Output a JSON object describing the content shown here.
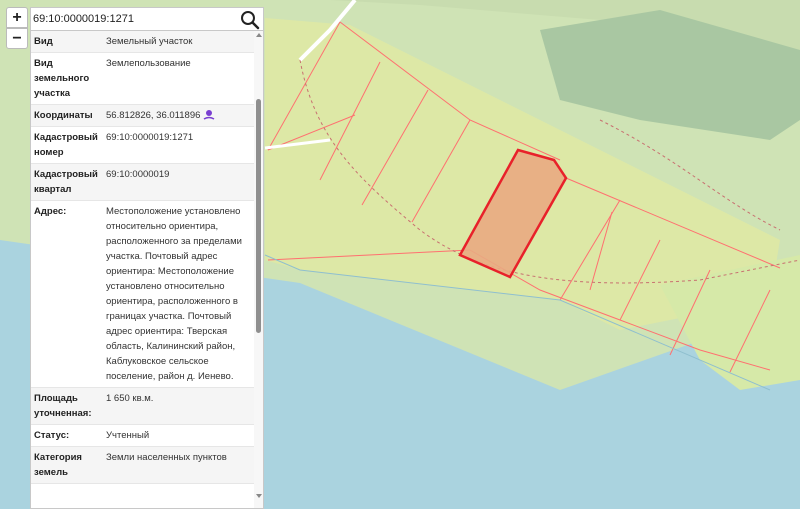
{
  "search": {
    "value": "69:10:0000019:1271"
  },
  "zoom": {
    "in_label": "+",
    "out_label": "−"
  },
  "info": {
    "rows": [
      {
        "key": "Вид",
        "value": "Земельный участок"
      },
      {
        "key": "Вид земельного участка",
        "value": "Землепользование"
      },
      {
        "key": "Координаты",
        "value": "56.812826, 36.011896"
      },
      {
        "key": "Кадастровый номер",
        "value": "69:10:0000019:1271"
      },
      {
        "key": "Кадастровый квартал",
        "value": "69:10:0000019"
      },
      {
        "key": "Адрес:",
        "value": "Местоположение установлено относительно ориентира, расположенного за пределами участка. Почтовый адрес ориентира: Местоположение установлено относительно ориентира, расположенного в границах участка. Почтовый адрес ориентира: Тверская область, Калининский район, Каблуковское сельское поселение, район д. Иенево."
      },
      {
        "key": "Площадь уточненная:",
        "value": "1 650 кв.м."
      },
      {
        "key": "Статус:",
        "value": "Учтенный"
      },
      {
        "key": "Категория земель",
        "value": "Земли населенных пунктов"
      }
    ]
  },
  "icons": {
    "search": "search-icon",
    "coordinates": "map-pin-icon"
  },
  "colors": {
    "water": "#aad3df",
    "land": "#cfe3b5",
    "forest": "#a9cfa0",
    "parcel_fill": "#e1e89c",
    "parcel_border": "#ff6666",
    "selected_fill": "#e9aa82",
    "selected_border": "#e8212a",
    "road": "#c5a35f"
  }
}
